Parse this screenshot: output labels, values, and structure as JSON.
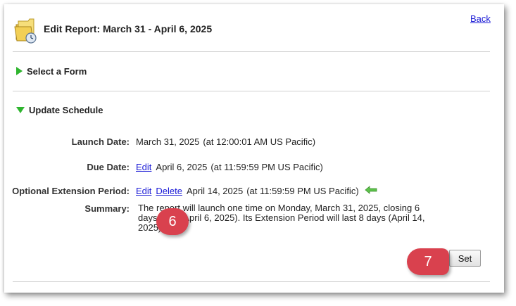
{
  "header": {
    "title": "Edit Report: March 31 - April 6, 2025",
    "back_label": "Back"
  },
  "sections": {
    "select_form": "Select a Form",
    "update_schedule": "Update Schedule"
  },
  "schedule": {
    "launch_label": "Launch Date:",
    "launch_value": "March 31, 2025",
    "launch_time": "(at 12:00:01 AM US Pacific)",
    "due_label": "Due Date:",
    "due_edit": "Edit",
    "due_value": "April 6, 2025",
    "due_time": "(at 11:59:59 PM US Pacific)",
    "ext_label": "Optional Extension Period:",
    "ext_edit": "Edit",
    "ext_delete": "Delete",
    "ext_value": "April 14, 2025",
    "ext_time": "(at 11:59:59 PM US Pacific)",
    "summary_label": "Summary:",
    "summary_text": "The report will launch one time on Monday, March 31, 2025, closing 6 days later (April 6, 2025). Its Extension Period will last 8 days (April 14, 2025)."
  },
  "actions": {
    "set_label": "Set"
  },
  "callouts": {
    "step_6": "6",
    "step_7": "7"
  },
  "colors": {
    "accent_green": "#2fb52f",
    "link_blue": "#1a1ad6",
    "callout_red": "#d9414e"
  },
  "icons": {
    "header": "folder-clock-icon",
    "section_collapsed": "triangle-right-icon",
    "section_expanded": "triangle-down-icon",
    "pointer": "arrow-left-icon"
  }
}
